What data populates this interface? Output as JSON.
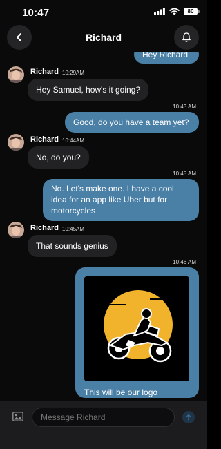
{
  "status": {
    "time": "10:47",
    "battery": "80"
  },
  "header": {
    "title": "Richard"
  },
  "messages": [
    {
      "type": "out",
      "text": "Hey Richard"
    },
    {
      "type": "in",
      "sender": "Richard",
      "time": "10:29AM",
      "text": "Hey Samuel, how's it going?"
    },
    {
      "type": "out",
      "time": "10:43 AM",
      "text": "Good, do you have a team yet?"
    },
    {
      "type": "in",
      "sender": "Richard",
      "time": "10:44AM",
      "text": "No, do you?"
    },
    {
      "type": "out",
      "time": "10:45 AM",
      "text": "No. Let's make one. I have a cool idea for an app like Uber but for motorcycles"
    },
    {
      "type": "in",
      "sender": "Richard",
      "time": "10:45AM",
      "text": "That sounds genius"
    },
    {
      "type": "out-image",
      "time": "10:46 AM",
      "image": "motorcycle-logo",
      "caption": "This will be our logo"
    }
  ],
  "composer": {
    "placeholder": "Message Richard"
  },
  "colors": {
    "background": "#0a0a0a",
    "outgoing_bubble": "#4a7fa6",
    "incoming_bubble": "#222225",
    "logo_sun": "#f2b32c"
  }
}
